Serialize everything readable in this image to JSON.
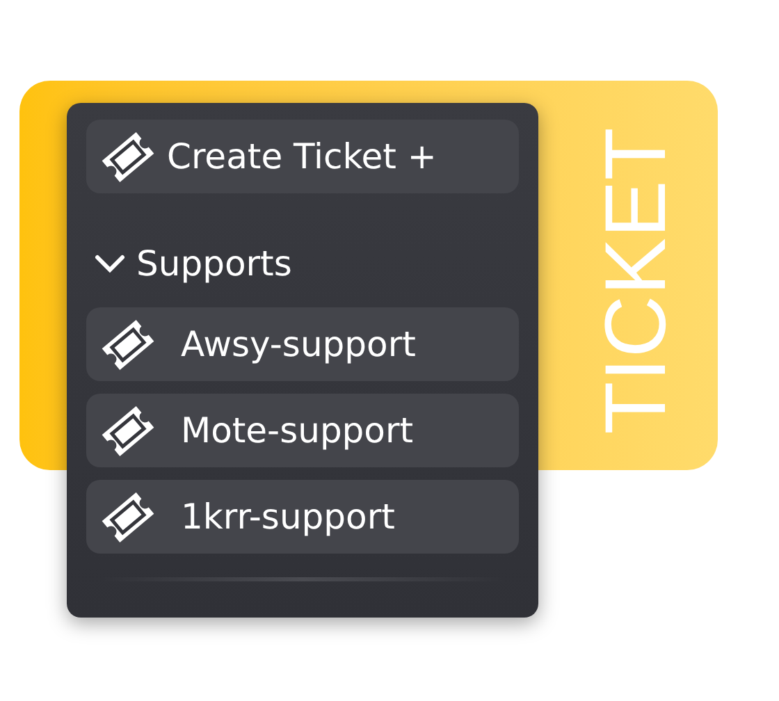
{
  "banner": {
    "text": "TICKET"
  },
  "menu": {
    "create_button": {
      "label": "Create Ticket +"
    },
    "section": {
      "label": "Supports",
      "expanded": true
    },
    "channels": [
      {
        "label": "Awsy-support"
      },
      {
        "label": "Mote-support"
      },
      {
        "label": "1krr-support"
      }
    ]
  }
}
